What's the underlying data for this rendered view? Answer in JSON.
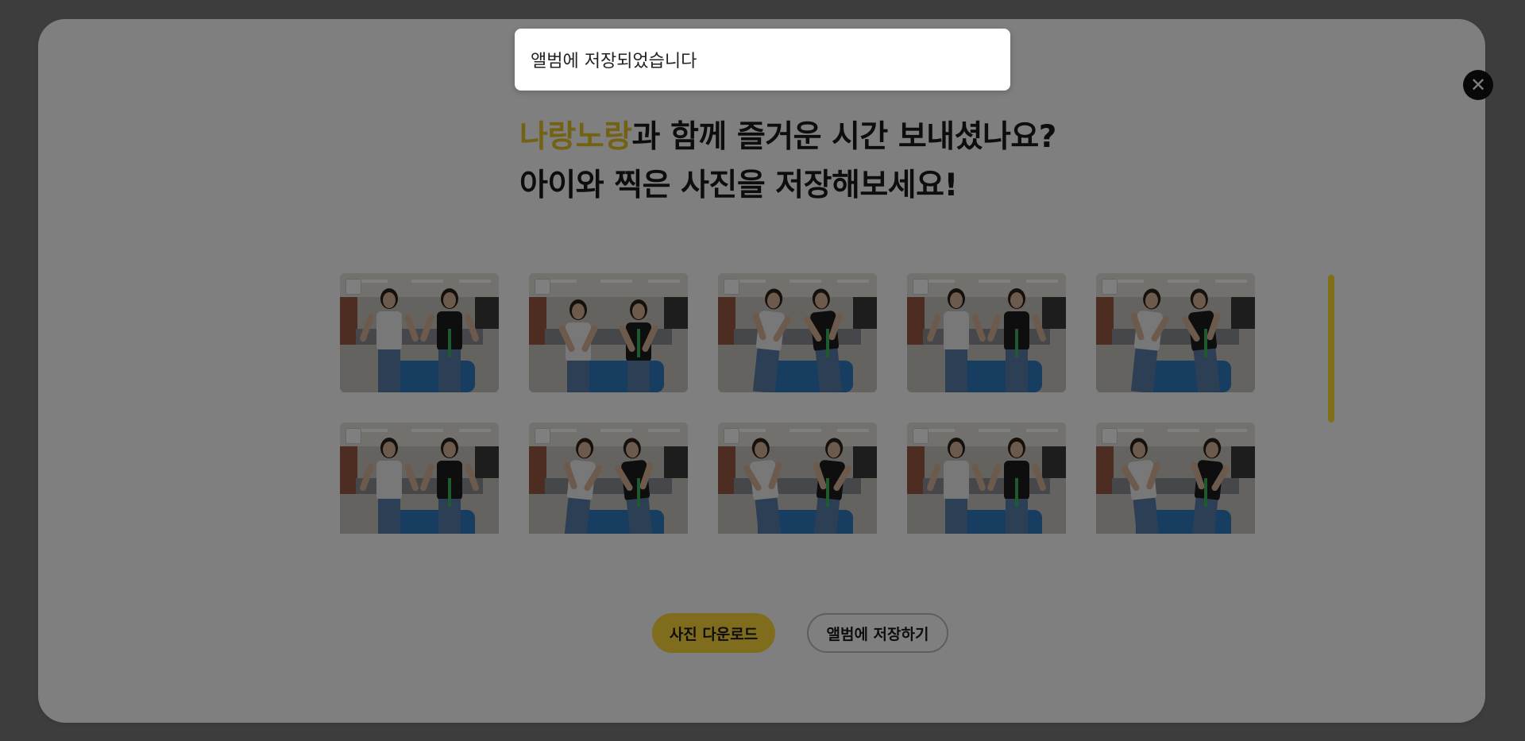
{
  "modal": {
    "close_symbol": "✕",
    "heading": {
      "brand": "나랑노랑",
      "line1_rest": "과 함께 즐거운 시간 보내셨나요?",
      "line2": "아이와 찍은 사진을 저장해보세요!"
    },
    "photos": [
      {
        "variant": "standing",
        "selected": false
      },
      {
        "variant": "leaning",
        "selected": false
      },
      {
        "variant": "dancing",
        "selected": false
      },
      {
        "variant": "standing",
        "selected": false
      },
      {
        "variant": "dancing",
        "selected": false
      },
      {
        "variant": "standing",
        "selected": false
      },
      {
        "variant": "dancing",
        "selected": false
      },
      {
        "variant": "dancing",
        "selected": false
      },
      {
        "variant": "standing",
        "selected": false
      },
      {
        "variant": "dancing",
        "selected": false
      }
    ],
    "buttons": {
      "download_label": "사진 다운로드",
      "save_album_label": "앨범에 저장하기"
    }
  },
  "toast": {
    "message": "앨범에 저장되었습니다"
  },
  "colors": {
    "accent": "#ffd93a",
    "brand_text": "#e6c229",
    "scrollbar": "#ffdf2e",
    "backdrop": "#7a7a7a"
  }
}
